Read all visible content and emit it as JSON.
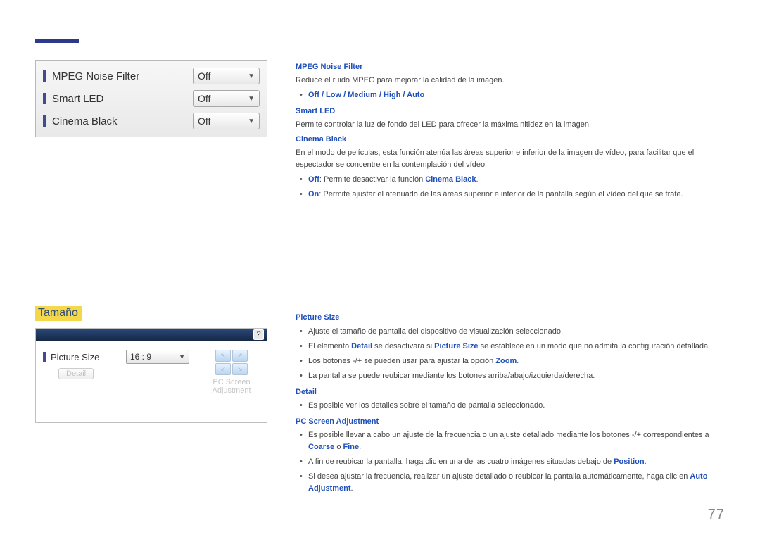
{
  "osd1": {
    "rows": [
      {
        "label": "MPEG Noise Filter",
        "value": "Off"
      },
      {
        "label": "Smart LED",
        "value": "Off"
      },
      {
        "label": "Cinema Black",
        "value": "Off"
      }
    ]
  },
  "section_heading": "Tamaño",
  "osd2": {
    "help_char": "?",
    "picture_size_label": "Picture Size",
    "picture_size_value": "16 : 9",
    "detail_label": "Detail",
    "pc_screen_line1": "PC Screen",
    "pc_screen_line2": "Adjustment"
  },
  "text": {
    "mpeg_h": "MPEG Noise Filter",
    "mpeg_desc": "Reduce el ruido MPEG para mejorar la calidad de la imagen.",
    "mpeg_opts": "Off / Low / Medium / High / Auto",
    "smart_h": "Smart LED",
    "smart_desc": "Permite controlar la luz de fondo del LED para ofrecer la máxima nitidez en la imagen.",
    "cinema_h": "Cinema Black",
    "cinema_desc": "En el modo de películas, esta función atenúa las áreas superior e inferior de la imagen de vídeo, para facilitar que el espectador se concentre en la contemplación del vídeo.",
    "cinema_off_kw": "Off",
    "cinema_off_txt": ": Permite desactivar la función ",
    "cinema_off_kw2": "Cinema Black",
    "cinema_on_kw": "On",
    "cinema_on_txt": ": Permite ajustar el atenuado de las áreas superior e inferior de la pantalla según el vídeo del que se trate.",
    "ps_h": "Picture Size",
    "ps_b1": "Ajuste el tamaño de pantalla del dispositivo de visualización seleccionado.",
    "ps_b2a": "El elemento ",
    "ps_b2_kw1": "Detail",
    "ps_b2b": " se desactivará si ",
    "ps_b2_kw2": "Picture Size",
    "ps_b2c": " se establece en un modo que no admita la configuración detallada.",
    "ps_b3a": "Los botones -/+ se pueden usar para ajustar la opción ",
    "ps_b3_kw": "Zoom",
    "ps_b4": "La pantalla se puede reubicar mediante los botones arriba/abajo/izquierda/derecha.",
    "detail_h": "Detail",
    "detail_b1": "Es posible ver los detalles sobre el tamaño de pantalla seleccionado.",
    "pcsa_h": "PC Screen Adjustment",
    "pcsa_b1a": "Es posible llevar a cabo un ajuste de la frecuencia o un ajuste detallado mediante los botones -/+ correspondientes a ",
    "pcsa_b1_kw1": "Coarse",
    "pcsa_b1_mid": " o ",
    "pcsa_b1_kw2": "Fine",
    "pcsa_b2a": "A fin de reubicar la pantalla, haga clic en una de las cuatro imágenes situadas debajo de ",
    "pcsa_b2_kw": "Position",
    "pcsa_b3a": "Si desea ajustar la frecuencia, realizar un ajuste detallado o reubicar la pantalla automáticamente, haga clic en ",
    "pcsa_b3_kw": "Auto Adjustment"
  },
  "page_number": "77"
}
